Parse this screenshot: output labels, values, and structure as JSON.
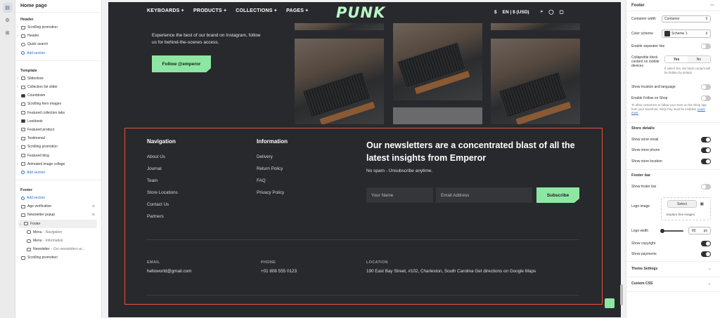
{
  "left_panel": {
    "title": "Home page",
    "header_group": {
      "title": "Header",
      "items": [
        "Scrolling promotion",
        "Header",
        "Quick search"
      ],
      "add": "Add section"
    },
    "template_group": {
      "title": "Template",
      "items": [
        "Slideshow",
        "Collection list slider",
        "Countdown",
        "Scrolling hero images",
        "Featured collection tabs",
        "Lookbook",
        "Featured product",
        "Testimonial",
        "Scrolling promotion",
        "Featured blog",
        "Animated image collage"
      ],
      "add": "Add section"
    },
    "footer_group": {
      "title": "Footer",
      "add": "Add section",
      "items": [
        "Age verification",
        "Newsletter popup",
        "Footer"
      ],
      "children": [
        {
          "label": "Menu",
          "sub": "- Navigation"
        },
        {
          "label": "Menu",
          "sub": "- Information"
        },
        {
          "label": "Newsletter",
          "sub": "- Our newsletters ar..."
        }
      ],
      "last": "Scrolling promotion"
    }
  },
  "site": {
    "nav": {
      "items": [
        "KEYBOARDS +",
        "PRODUCTS +",
        "COLLECTIONS +",
        "PAGES +"
      ],
      "logo": "PUNK",
      "locale": "EN | $ (USD)"
    },
    "instagram": {
      "text": "Experience the best of our brand on Instagram, follow us for behind-the-scenes access.",
      "button": "Follow @emperor"
    },
    "footer": {
      "navigation": {
        "title": "Navigation",
        "links": [
          "About Us",
          "Journal",
          "Team",
          "Store Locations",
          "Contact Us",
          "Partners"
        ]
      },
      "information": {
        "title": "Information",
        "links": [
          "Delivery",
          "Return Policy",
          "FAQ",
          "Privacy Policy"
        ]
      },
      "newsletter": {
        "heading": "Our newsletters are a concentrated blast of all the latest insights from Emperor",
        "sub": "No spam - Unsubscribe anytime.",
        "name_placeholder": "Your Name",
        "email_placeholder": "Email Address",
        "button": "Subscribe"
      },
      "contact": {
        "email_label": "EMAIL",
        "email": "helloworld@gmail.com",
        "phone_label": "PHONE",
        "phone": "+01 808 555 0123",
        "location_label": "LOCATION",
        "location": "190 East Bay Street, #102, Charleston, South Carolina Get directions on Google Maps"
      }
    }
  },
  "right_panel": {
    "title": "Footer",
    "container_width_label": "Container width",
    "container_width_value": "Container",
    "color_scheme_label": "Color scheme",
    "color_scheme_value": "Scheme 1",
    "separator_label": "Enable separator line",
    "collapsible_label": "Collapsible block content on mobile devices",
    "collapsible_yes": "Yes",
    "collapsible_no": "No",
    "collapsible_help": "If select Yes, the block content will be hidden by default",
    "location_language_label": "Show location and language",
    "follow_shop_label": "Enable Follow on Shop",
    "follow_shop_help": "To allow customers to follow your store on the Shop app from your storefront, Shop Pay must be enabled.",
    "learn_more": "Learn more",
    "store_details_title": "Store details",
    "store_email_label": "Show store email",
    "store_phone_label": "Show store phone",
    "store_location_label": "Show store location",
    "footer_bar_title": "Footer bar",
    "show_footer_bar_label": "Show footer bar",
    "logo_image_label": "Logo image",
    "select_button": "Select",
    "explore_images": "Explore free images",
    "logo_width_label": "Logo width",
    "logo_width_value": "80",
    "logo_width_unit": "px",
    "copyright_label": "Show copyright",
    "payments_label": "Show payments",
    "theme_settings": "Theme Settings",
    "custom_css": "Custom CSS",
    "toggles": {
      "separator": false,
      "location_language": false,
      "follow_shop": false,
      "store_email": true,
      "store_phone": true,
      "store_location": true,
      "footer_bar": false,
      "copyright": true,
      "payments": true
    }
  }
}
